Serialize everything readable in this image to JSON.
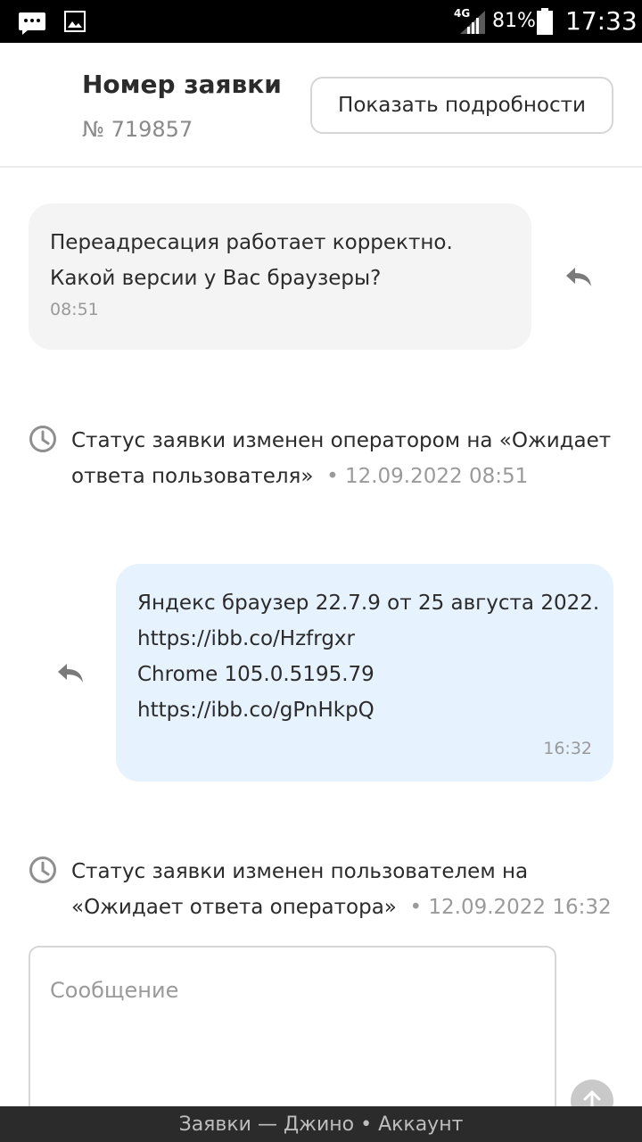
{
  "status_bar": {
    "network": "4G",
    "battery": "81%",
    "time": "17:33",
    "icons": [
      "message-icon",
      "image-icon",
      "signal-icon",
      "battery-icon"
    ]
  },
  "header": {
    "title": "Номер заявки",
    "ticket_number": "№ 719857",
    "details_button": "Показать подробности"
  },
  "messages": [
    {
      "direction": "incoming",
      "lines": [
        "Переадресация работает корректно.",
        "Какой версии у Вас браузеры?"
      ],
      "time": "08:51"
    },
    {
      "direction": "outgoing",
      "lines": [
        "Яндекс браузер 22.7.9 от 25 августа 2022.",
        "https://ibb.co/Hzfrgxr",
        "Chrome 105.0.5195.79",
        "https://ibb.co/gPnHkpQ"
      ],
      "time": "16:32"
    }
  ],
  "status_changes": [
    {
      "line1": "Статус заявки изменен оператором на «Ожидает",
      "line2": "ответа пользователя»",
      "date": "• 12.09.2022 08:51"
    },
    {
      "line1": "Статус заявки изменен пользователем на",
      "line2": "«Ожидает ответа оператора»",
      "date": "• 12.09.2022 16:32"
    }
  ],
  "composer": {
    "placeholder": "Сообщение",
    "value": ""
  },
  "bottom_bar": {
    "text": "Заявки — Джино • Аккаунт"
  },
  "colors": {
    "incoming_bubble": "#f4f4f4",
    "outgoing_bubble": "#e6f2fd",
    "muted_text": "#9a9a9a",
    "bottom_bar": "#2b2b2b"
  }
}
